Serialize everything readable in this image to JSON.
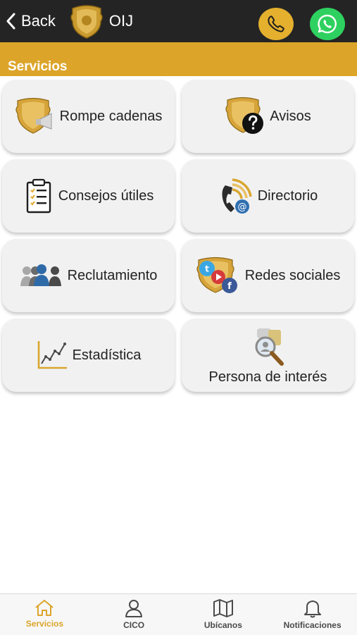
{
  "header": {
    "back_label": "Back",
    "brand": "OIJ",
    "phone_button_color": "#e4b02d",
    "whatsapp_button_color": "#2ed15f",
    "background": "#242424"
  },
  "section": {
    "title": "Servicios",
    "color": "#dca52a"
  },
  "services": [
    {
      "label": "Rompe cadenas",
      "icon": "badge-megaphone-icon"
    },
    {
      "label": "Avisos",
      "icon": "badge-question-icon"
    },
    {
      "label": "Consejos útiles",
      "icon": "clipboard-checklist-icon"
    },
    {
      "label": "Directorio",
      "icon": "phone-email-icon"
    },
    {
      "label": "Reclutamiento",
      "icon": "people-group-icon"
    },
    {
      "label": "Redes sociales",
      "icon": "badge-social-icon"
    },
    {
      "label": "Estadística",
      "icon": "line-chart-icon"
    },
    {
      "label": "Persona de interés",
      "icon": "magnifier-person-icon"
    }
  ],
  "bottom_nav": [
    {
      "label": "Servicios",
      "icon": "home-icon",
      "active": true
    },
    {
      "label": "CICO",
      "icon": "user-icon",
      "active": false
    },
    {
      "label": "Ubícanos",
      "icon": "map-icon",
      "active": false
    },
    {
      "label": "Notificaciones",
      "icon": "bell-icon",
      "active": false
    }
  ]
}
